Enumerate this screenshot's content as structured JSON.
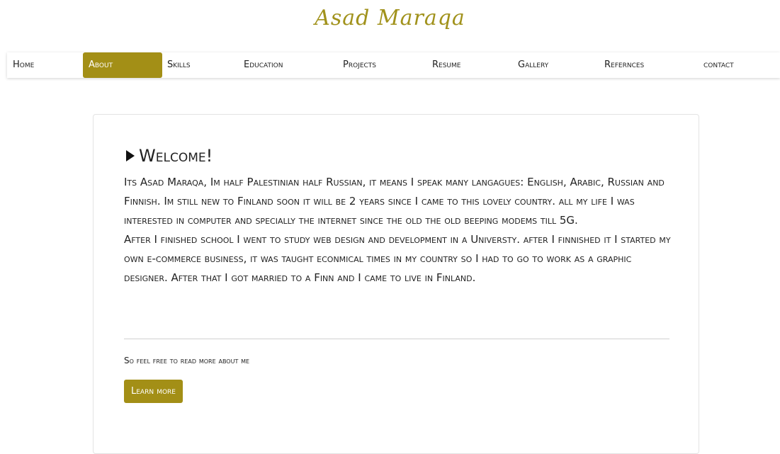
{
  "site": {
    "logo": "Asad Maraqa"
  },
  "nav": {
    "items": [
      {
        "label": "Home"
      },
      {
        "label": "About"
      },
      {
        "label": "Skills"
      },
      {
        "label": "Education"
      },
      {
        "label": "Projects"
      },
      {
        "label": "Resume"
      },
      {
        "label": "Gallery"
      },
      {
        "label": "Refernces"
      },
      {
        "label": "contact"
      }
    ],
    "active": "About"
  },
  "main": {
    "heading": "Welcome!",
    "paragraph_1": "Its Asad Maraqa, Im half Palestinian half Russian, it means I speak many langagues: English, Arabic, Russian and Finnish. Im still new to Finland soon it will be 2 years since I came to this lovely country. all my life I was interested in computer and specially the internet since the old the old beeping modems till 5G.",
    "paragraph_2": "After I finished school I went to study web design and development in a Universty. after I finnished it I started my own e-commerce business, it was taught econmical times in my country so I had to go to work as a graphic designer. After that I got married to a Finn and I came to live in Finland.",
    "feel_free": "So feel free to read more about me",
    "learn_more": "Learn more"
  },
  "colors": {
    "accent": "#a38f16",
    "logo": "#a1921c"
  },
  "icons": {
    "heading_icon": "triangle-right-icon"
  }
}
